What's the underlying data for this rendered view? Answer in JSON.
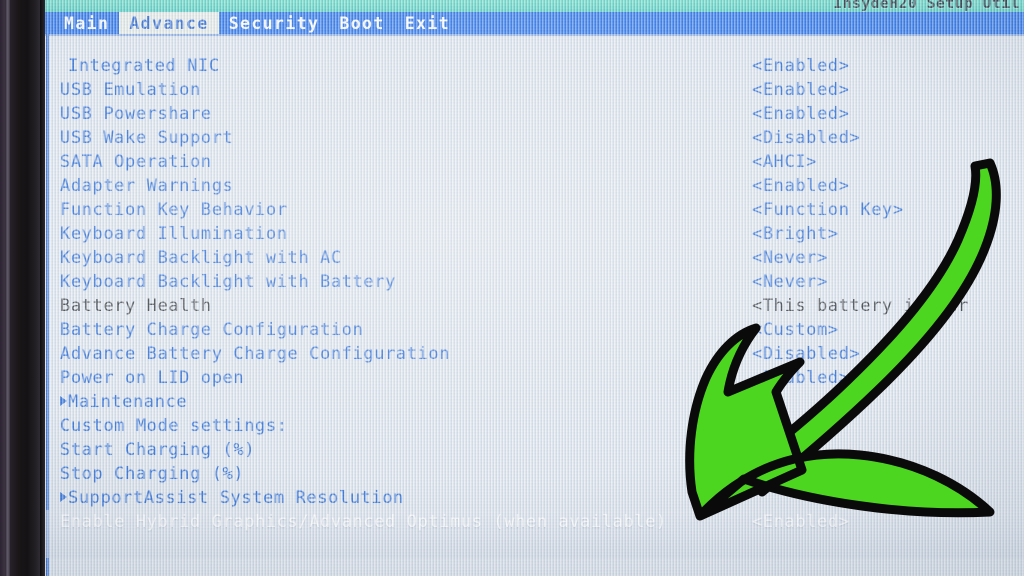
{
  "window": {
    "utility_title": "InsydeH20 Setup Util"
  },
  "menubar": {
    "tabs": [
      {
        "label": "Main",
        "active": false
      },
      {
        "label": "Advance",
        "active": true
      },
      {
        "label": "Security",
        "active": false
      },
      {
        "label": "Boot",
        "active": false
      },
      {
        "label": "Exit",
        "active": false
      }
    ]
  },
  "settings": {
    "rows": [
      {
        "label": "Integrated NIC",
        "value": "<Enabled>"
      },
      {
        "label": "USB Emulation",
        "value": "<Enabled>"
      },
      {
        "label": "USB Powershare",
        "value": "<Enabled>"
      },
      {
        "label": "USB Wake Support",
        "value": "<Disabled>"
      },
      {
        "label": "SATA Operation",
        "value": "<AHCI>"
      },
      {
        "label": "Adapter Warnings",
        "value": "<Enabled>"
      },
      {
        "label": "Function Key Behavior",
        "value": "<Function Key>"
      },
      {
        "label": "Keyboard Illumination",
        "value": "<Bright>"
      },
      {
        "label": "Keyboard Backlight with AC",
        "value": "<Never>"
      },
      {
        "label": "Keyboard Backlight with Battery",
        "value": "<Never>"
      },
      {
        "label": "Battery Health",
        "value": "<This battery is per"
      },
      {
        "label": "Battery Charge Configuration",
        "value": "<Custom>"
      },
      {
        "label": "Advance Battery Charge Configuration",
        "value": "<Disabled>"
      },
      {
        "label": "Power on LID open",
        "value": "<Enabled>"
      },
      {
        "label": "Maintenance",
        "value": ""
      },
      {
        "label": "Custom Mode settings:",
        "value": ""
      },
      {
        "label": "Start Charging (%)",
        "value": ""
      },
      {
        "label": "Stop Charging (%)",
        "value": ""
      },
      {
        "label": "SupportAssist System Resolution",
        "value": ""
      },
      {
        "label": "Enable Hybrid Graphics/Advanced Optimus (when available)",
        "value": "<Enabled>"
      }
    ]
  },
  "annotation": {
    "arrow_name": "green-curved-arrow",
    "arrow_fill": "#4cd61f",
    "arrow_stroke": "#0a0a0a",
    "points_to": "Enable Hybrid Graphics/Advanced Optimus (when available)"
  },
  "colors": {
    "screen_background": "#dde4ec",
    "label_blue": "#1a62d8",
    "menubar_blue": "#1565e8",
    "active_tab_background": "#e6ebe6",
    "titlebar_teal": "#4fd0bd",
    "disabled_text": "#20242b",
    "selected_text": "#ffffff"
  }
}
